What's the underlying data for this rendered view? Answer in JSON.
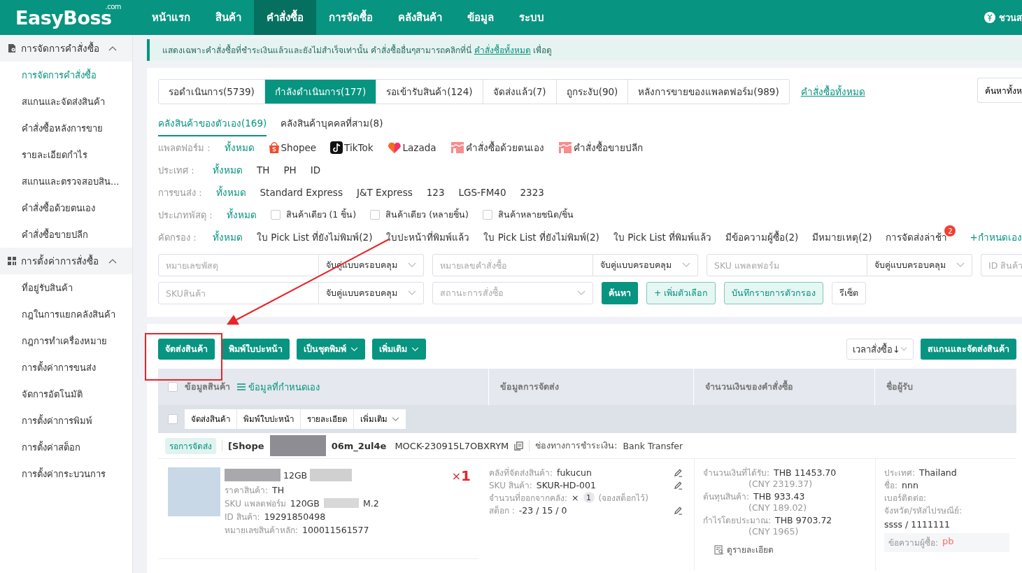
{
  "logo": {
    "text": "EasyBoss",
    "superscript": ".com"
  },
  "nav": [
    {
      "label": "หน้าแรก",
      "selected": false
    },
    {
      "label": "สินค้า",
      "selected": false
    },
    {
      "label": "คำสั่งซื้อ",
      "selected": true
    },
    {
      "label": "การจัดซื้อ",
      "selected": false
    },
    {
      "label": "คลังสินค้า",
      "selected": false
    },
    {
      "label": "ข้อมูล",
      "selected": false
    },
    {
      "label": "ระบบ",
      "selected": false
    }
  ],
  "header_right": {
    "text": "ชวนส"
  },
  "sidebar": [
    {
      "title": "การจัดการคำสั่งซื้อ",
      "expanded": true,
      "items": [
        {
          "label": "การจัดการคำสั่งซื้อ",
          "selected": true
        },
        {
          "label": "สแกนและจัดส่งสินค้า",
          "selected": false
        },
        {
          "label": "คำสั่งซื้อหลังการขาย",
          "selected": false
        },
        {
          "label": "รายละเอียดกำไร",
          "selected": false
        },
        {
          "label": "สแกนและตรวจสอบสิน...",
          "selected": false
        },
        {
          "label": "คำสั่งซื้อด้วยตนเอง",
          "selected": false
        },
        {
          "label": "คำสั่งซื้อขายปลีก",
          "selected": false
        }
      ]
    },
    {
      "title": "การตั้งค่าการสั่งซื้อ",
      "expanded": true,
      "items": [
        {
          "label": "ที่อยู่รับสินค้า",
          "selected": false
        },
        {
          "label": "กฎในการแยกคลังสินค้า",
          "selected": false
        },
        {
          "label": "กฎการทำเครื่องหมาย",
          "selected": false
        },
        {
          "label": "การตั้งค่าการขนส่ง",
          "selected": false
        },
        {
          "label": "จัดการอัตโนมัติ",
          "selected": false
        },
        {
          "label": "การตั้งค่าการพิมพ์",
          "selected": false
        },
        {
          "label": "การตั้งค่าสต็อก",
          "selected": false
        },
        {
          "label": "การตั้งค่ากระบวนการ",
          "selected": false
        }
      ]
    }
  ],
  "notice": {
    "text": "แสดงเฉพาะคำสั่งซื้อที่ชำระเงินแล้วและยังไม่สำเร็จเท่านั้น คำสั่งซื้ออื่นๆสามารถคลิกที่นี่",
    "link": "คำสั่งซื้อทั้งหมด",
    "suffix": "เพื่อดู"
  },
  "status_tabs": [
    {
      "label": "รอดำเนินการ(5739)",
      "selected": false
    },
    {
      "label": "กำลังดำเนินการ(177)",
      "selected": true
    },
    {
      "label": "รอเข้ารับสินค้า(124)",
      "selected": false
    },
    {
      "label": "จัดส่งแล้ว(7)",
      "selected": false
    },
    {
      "label": "ถูกระงับ(90)",
      "selected": false
    },
    {
      "label": "หลังการขายของแพลตฟอร์ม(989)",
      "selected": false
    }
  ],
  "all_orders_link": "คำสั่งซื้อทั้งหมด",
  "search_all": "ค้นหาทั้งห",
  "warehouse_tabs": [
    {
      "label": "คลังสินค้าของตัวเอง(169)",
      "selected": true
    },
    {
      "label": "คลังสินค้าบุคคลที่สาม(8)",
      "selected": false
    }
  ],
  "filters": [
    {
      "label": "แพลตฟอร์ม :",
      "options": [
        {
          "label": "ทั้งหมด",
          "kind": "text",
          "selected": true
        },
        {
          "label": "Shopee",
          "kind": "shopee",
          "selected": false
        },
        {
          "label": "TikTok",
          "kind": "tiktok",
          "selected": false
        },
        {
          "label": "Lazada",
          "kind": "lazada",
          "selected": false
        },
        {
          "label": "คำสั่งซื้อด้วยตนเอง",
          "kind": "manual",
          "selected": false
        },
        {
          "label": "คำสั่งซื้อขายปลีก",
          "kind": "retail",
          "selected": false
        }
      ]
    },
    {
      "label": "ประเทศ :",
      "options": [
        {
          "label": "ทั้งหมด",
          "kind": "text",
          "selected": true
        },
        {
          "label": "TH",
          "kind": "text",
          "selected": false
        },
        {
          "label": "PH",
          "kind": "text",
          "selected": false
        },
        {
          "label": "ID",
          "kind": "text",
          "selected": false
        }
      ]
    },
    {
      "label": "การขนส่ง :",
      "options": [
        {
          "label": "ทั้งหมด",
          "kind": "text",
          "selected": true
        },
        {
          "label": "Standard Express",
          "kind": "text",
          "selected": false
        },
        {
          "label": "J&T Express",
          "kind": "text",
          "selected": false
        },
        {
          "label": "123",
          "kind": "text",
          "selected": false
        },
        {
          "label": "LGS-FM40",
          "kind": "text",
          "selected": false
        },
        {
          "label": "2323",
          "kind": "text",
          "selected": false
        }
      ]
    },
    {
      "label": "ประเภทพัสดุ :",
      "options": [
        {
          "label": "ทั้งหมด",
          "kind": "text",
          "selected": true
        },
        {
          "label": "สินค้าเดียว (1 ชิ้น)",
          "kind": "checkbox",
          "checked": false
        },
        {
          "label": "สินค้าเดียว (หลายชิ้น)",
          "kind": "checkbox",
          "checked": false
        },
        {
          "label": "สินค้าหลายชนิด/ชิ้น",
          "kind": "checkbox",
          "checked": false
        }
      ]
    },
    {
      "label": "คัดกรอง :",
      "options": [
        {
          "label": "ทั้งหมด",
          "kind": "text",
          "selected": true
        },
        {
          "label": "ใบ Pick List ที่ยังไม่พิมพ์(2)",
          "kind": "text",
          "selected": false
        },
        {
          "label": "ใบปะหน้าที่พิมพ์แล้ว",
          "kind": "text",
          "selected": false
        },
        {
          "label": "ใบ Pick List ที่ยังไม่พิมพ์(2)",
          "kind": "text",
          "selected": false
        },
        {
          "label": "ใบ Pick List ที่พิมพ์แล้ว",
          "kind": "text",
          "selected": false
        },
        {
          "label": "มีข้อความผู้ซื้อ(2)",
          "kind": "text",
          "selected": false
        },
        {
          "label": "มีหมายเหตุ(2)",
          "kind": "text",
          "selected": false
        },
        {
          "label": "การจัดส่งล่าช้า",
          "kind": "text",
          "selected": false,
          "badge": "2"
        },
        {
          "label": "+กำหนดเอง",
          "kind": "add"
        }
      ]
    }
  ],
  "search_rows": [
    [
      {
        "kind": "field",
        "placeholder": "หมายเลขพัสดุ",
        "match": "จับคู่แบบครอบคลุม"
      },
      {
        "kind": "field",
        "placeholder": "หมายเลขคำสั่งซื้อ",
        "match": "จับคู่แบบครอบคลุม"
      },
      {
        "kind": "field",
        "placeholder": "SKU แพลตฟอร์ม",
        "match": "จับคู่แบบครอบคลุม"
      },
      {
        "kind": "cut",
        "placeholder": "ID สินค้า"
      }
    ],
    [
      {
        "kind": "field",
        "placeholder": "SKUสินค้า",
        "match": "จับคู่แบบครอบคลุม"
      },
      {
        "kind": "select",
        "placeholder": "สถานะการสั่งซื้อ"
      },
      {
        "kind": "primary",
        "label": "ค้นหา"
      },
      {
        "kind": "light",
        "label": "+ เพิ่มตัวเลือก"
      },
      {
        "kind": "light",
        "label": "บันทึกรายการตัวกรอง"
      },
      {
        "kind": "plain",
        "label": "รีเซ็ต"
      }
    ]
  ],
  "actions": [
    {
      "label": "จัดส่งสินค้า",
      "dropdown": false
    },
    {
      "label": "พิมพ์ใบปะหน้า",
      "dropdown": false
    },
    {
      "label": "เป็นชุดพิมพ์",
      "dropdown": true
    },
    {
      "label": "เพิ่มเติม",
      "dropdown": true
    }
  ],
  "sort": "เวลาสั่งซื้อ↓",
  "scan_button": "สแกนและจัดส่งสินค้า",
  "table": {
    "select_all_checked": false,
    "columns": [
      "ข้อมูลสินค้า",
      "ข้อมูลการจัดส่ง",
      "จำนวนเงินของคำสั่งซื้อ",
      "ชื่อผู้รับ"
    ],
    "custom_link": "ข้อมูลที่กำหนดเอง",
    "bulk_checked": false,
    "bulk_actions": [
      {
        "label": "จัดส่งสินค้า",
        "dropdown": false
      },
      {
        "label": "พิมพ์ใบปะหน้า",
        "dropdown": false
      },
      {
        "label": "รายละเอียด",
        "dropdown": false
      },
      {
        "label": "เพิ่มเติม",
        "dropdown": true
      }
    ]
  },
  "order": {
    "status": "รอการจัดส่ง",
    "shop_start": "[Shope",
    "shop_end": "06m_2ul4e",
    "order_no": "MOCK-230915L7OBXRYM",
    "payment_label": "ช่องทางการชำระเงิน:",
    "payment": "Bank Transfer",
    "product_title": "12GB",
    "product_lines": [
      {
        "label": "ราคาสินค้า:",
        "value": "TH"
      },
      {
        "label": "SKU แพลตฟอร์ม",
        "value": "120GB",
        "tail": "M.2"
      },
      {
        "label": "ID สินค้า:",
        "value": "19291850498"
      },
      {
        "label": "หมายเลขสินค้าหลัก:",
        "value": "100011561577"
      }
    ],
    "qty_sign": "×",
    "qty": "1",
    "shipping": [
      {
        "label": "คลังที่จัดส่งสินค้า:",
        "value": "fukucun",
        "kind": "edit"
      },
      {
        "label": "SKU สินค้า:",
        "value": "SKUR-HD-001",
        "kind": "edit"
      },
      {
        "label": "จำนวนที่ออกจากคลัง:",
        "value": "×",
        "count": "1",
        "note": "(จองสต็อกไว้)",
        "kind": "count"
      },
      {
        "label": "สต็อก :",
        "value": "-23 / 15 / 0",
        "kind": "edit"
      }
    ],
    "amounts": [
      {
        "label": "จำนวนเงินที่ได้รับ:",
        "value": "THB 11453.70",
        "sub": "(CNY 2319.37)"
      },
      {
        "label": "ต้นทุนสินค้า:",
        "value": "THB 933.43",
        "sub": "(CNY 189.02)"
      },
      {
        "label": "กำไรโดยประมาณ:",
        "value": "THB 9703.72",
        "sub": "(CNY 1965)"
      }
    ],
    "details_link": "ดูรายละเอียด",
    "recipient": [
      {
        "label": "ประเทศ:",
        "value": "Thailand"
      },
      {
        "label": "ชื่อ:",
        "value": "nnn"
      },
      {
        "label": "เบอร์ติดต่อ:"
      },
      {
        "label": "จังหวัด/รหัสไปรษณีย์:"
      }
    ],
    "address": "ssss / 1111111",
    "buyer_message_label": "ข้อความผู้ซื้อ:",
    "buyer_message": "pb"
  }
}
